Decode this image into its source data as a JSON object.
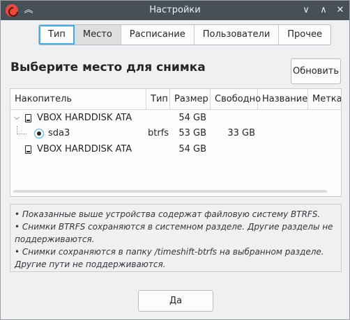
{
  "window": {
    "title": "Настройки",
    "buttons": {
      "minimize": "∨",
      "maximize": "∧",
      "close": "✕",
      "keep_above": "︽"
    }
  },
  "tabs": [
    {
      "label": "Тип",
      "state": "selected"
    },
    {
      "label": "Место",
      "state": "pressed"
    },
    {
      "label": "Расписание",
      "state": "normal"
    },
    {
      "label": "Пользователи",
      "state": "normal"
    },
    {
      "label": "Прочее",
      "state": "normal"
    }
  ],
  "heading": "Выберите место для снимка",
  "refresh_button": "Обновить",
  "table": {
    "columns": [
      "Накопитель",
      "Тип",
      "Размер",
      "Свободно",
      "Название",
      "Метка"
    ],
    "rows": [
      {
        "name": "VBOX HARDDISK ATA",
        "type": "",
        "size": "54 GB",
        "free": "",
        "label_name": "",
        "mark": "",
        "kind": "disk",
        "expanded": true
      },
      {
        "name": "sda3",
        "type": "btrfs",
        "size": "53 GB",
        "free": "33 GB",
        "label_name": "",
        "mark": "",
        "kind": "partition",
        "selected": true
      },
      {
        "name": "VBOX HARDDISK ATA",
        "type": "",
        "size": "54 GB",
        "free": "",
        "label_name": "",
        "mark": "",
        "kind": "disk",
        "expanded": false
      }
    ]
  },
  "info": [
    "• Показанные выше устройства содержат файловую систему BTRFS.",
    "• Снимки BTRFS сохраняются в системном разделе. Другие разделы не поддерживаются.",
    "• Снимки сохраняются в папку /timeshift-btrfs на выбранном разделе. Другие пути не поддерживаются."
  ],
  "ok_button": "Да",
  "colors": {
    "titlebar": "#475057",
    "accent": "#3daee9",
    "background": "#eff0f1"
  }
}
